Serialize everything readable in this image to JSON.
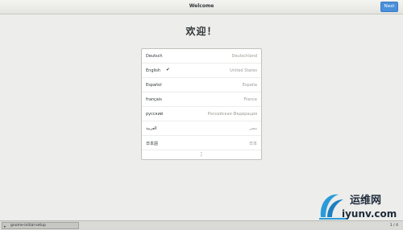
{
  "header": {
    "title": "Welcome",
    "next_label": "Next"
  },
  "welcome_heading": "欢迎！",
  "languages": [
    {
      "name": "Deutsch",
      "region": "Deutschland",
      "selected": false
    },
    {
      "name": "English",
      "region": "United States",
      "selected": true
    },
    {
      "name": "Español",
      "region": "España",
      "selected": false
    },
    {
      "name": "français",
      "region": "France",
      "selected": false
    },
    {
      "name": "русский",
      "region": "Российская Федерация",
      "selected": false
    },
    {
      "name": "العربية",
      "region": "مصر",
      "selected": false
    },
    {
      "name": "日本語",
      "region": "日本",
      "selected": false
    }
  ],
  "check_mark": "✔",
  "more_icon": "⋮",
  "taskbar": {
    "task_label": "gnome-initial-setup",
    "page_counter": "1 / 4"
  },
  "watermark": {
    "chinese": "运维网",
    "english": "iyunv.com"
  },
  "colors": {
    "accent": "#4a90d9",
    "background": "#ededeb"
  }
}
